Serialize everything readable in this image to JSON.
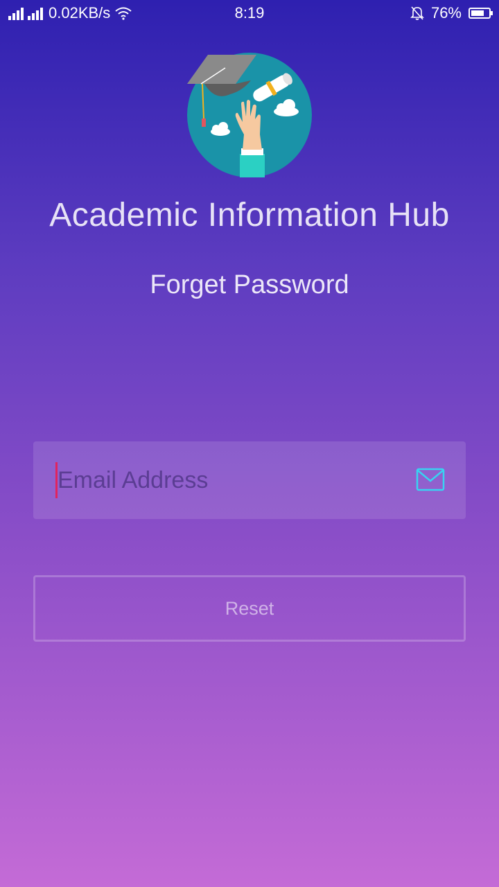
{
  "status_bar": {
    "net_speed": "0.02KB/s",
    "time": "8:19",
    "battery_percent": "76%",
    "battery_level": 0.76
  },
  "app": {
    "title": "Academic Information Hub",
    "logo_icon": "graduation-cap-diploma-icon"
  },
  "page": {
    "title": "Forget Password"
  },
  "form": {
    "email_placeholder": "Email Address",
    "email_value": "",
    "email_icon": "mail-icon",
    "reset_label": "Reset"
  },
  "colors": {
    "gradient_top": "#2e20b0",
    "gradient_bottom": "#c46bd6",
    "accent_icon": "#38d3f2",
    "cursor": "#e0245e"
  }
}
